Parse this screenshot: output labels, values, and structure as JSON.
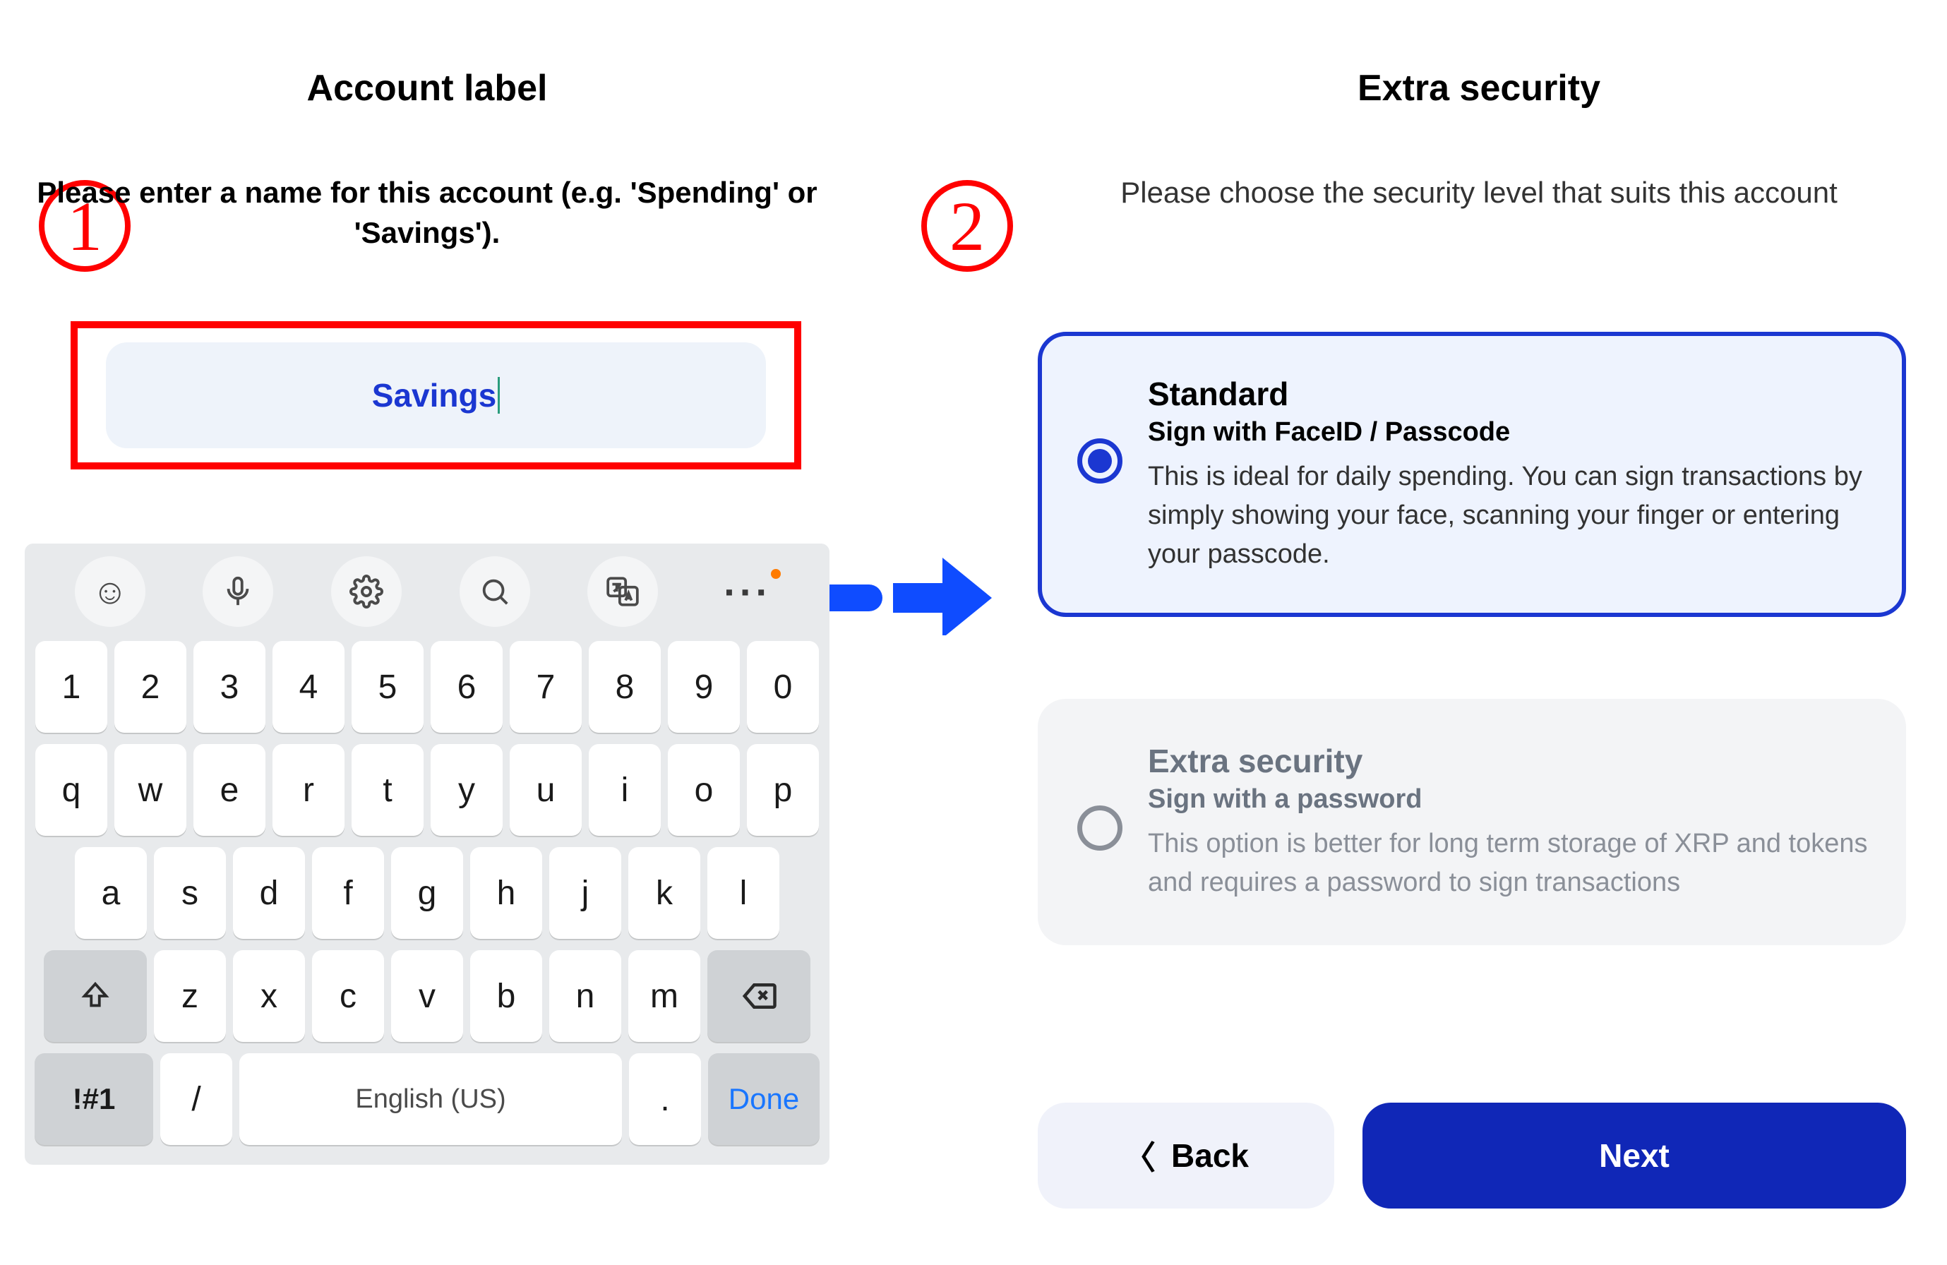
{
  "annotations": {
    "step1": "1",
    "step2": "2"
  },
  "left": {
    "title": "Account label",
    "subtitle": "Please enter a name for this account (e.g. 'Spending' or 'Savings').",
    "input_value": "Savings"
  },
  "keyboard": {
    "tool_emoji": "☺",
    "tool_mic": "mic",
    "tool_settings": "gear",
    "tool_search": "search",
    "tool_translate": "translate",
    "row_num": [
      "1",
      "2",
      "3",
      "4",
      "5",
      "6",
      "7",
      "8",
      "9",
      "0"
    ],
    "row_q": [
      "q",
      "w",
      "e",
      "r",
      "t",
      "y",
      "u",
      "i",
      "o",
      "p"
    ],
    "row_a": [
      "a",
      "s",
      "d",
      "f",
      "g",
      "h",
      "j",
      "k",
      "l"
    ],
    "row_z": [
      "z",
      "x",
      "c",
      "v",
      "b",
      "n",
      "m"
    ],
    "shift": "⇧",
    "backspace": "⌫",
    "symbols": "!#1",
    "slash": "/",
    "space": "English (US)",
    "period": ".",
    "done": "Done"
  },
  "right": {
    "title": "Extra security",
    "subtitle": "Please choose the security level that suits this account",
    "options": [
      {
        "title": "Standard",
        "subtitle": "Sign with FaceID / Passcode",
        "desc": "This is ideal for daily spending. You can sign transactions by simply showing your face, scanning your finger or entering your passcode.",
        "selected": true
      },
      {
        "title": "Extra security",
        "subtitle": "Sign with a password",
        "desc": "This option is better for long term storage of XRP and tokens and requires a password to sign transactions",
        "selected": false
      }
    ],
    "back_label": "Back",
    "next_label": "Next"
  }
}
